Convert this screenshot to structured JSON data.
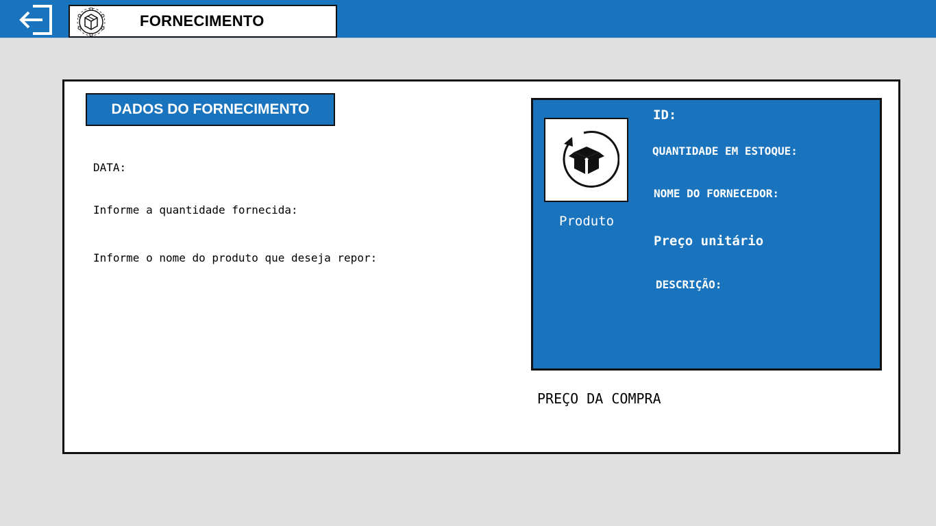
{
  "header": {
    "title": "FORNECIMENTO",
    "exit_icon": "exit-icon",
    "logo_icon": "package-network-icon"
  },
  "form": {
    "section_title": "DADOS DO FORNECIMENTO",
    "date_label": "DATA:",
    "quantity_label": "Informe a quantidade fornecida:",
    "product_name_label": "Informe o nome do produto que deseja repor:"
  },
  "product": {
    "image_icon": "box-refresh-icon",
    "caption": "Produto",
    "id_label": "ID:",
    "stock_label": "QUANTIDADE EM ESTOQUE:",
    "supplier_label": "NOME DO FORNECEDOR:",
    "unit_price_label": "Preço unitário",
    "description_label": "DESCRIÇÃO:"
  },
  "purchase_price_label": "PREÇO DA COMPRA",
  "colors": {
    "primary_blue": "#1a73bd",
    "background": "#e0e0e0",
    "card": "#ffffff",
    "border": "#111111"
  }
}
